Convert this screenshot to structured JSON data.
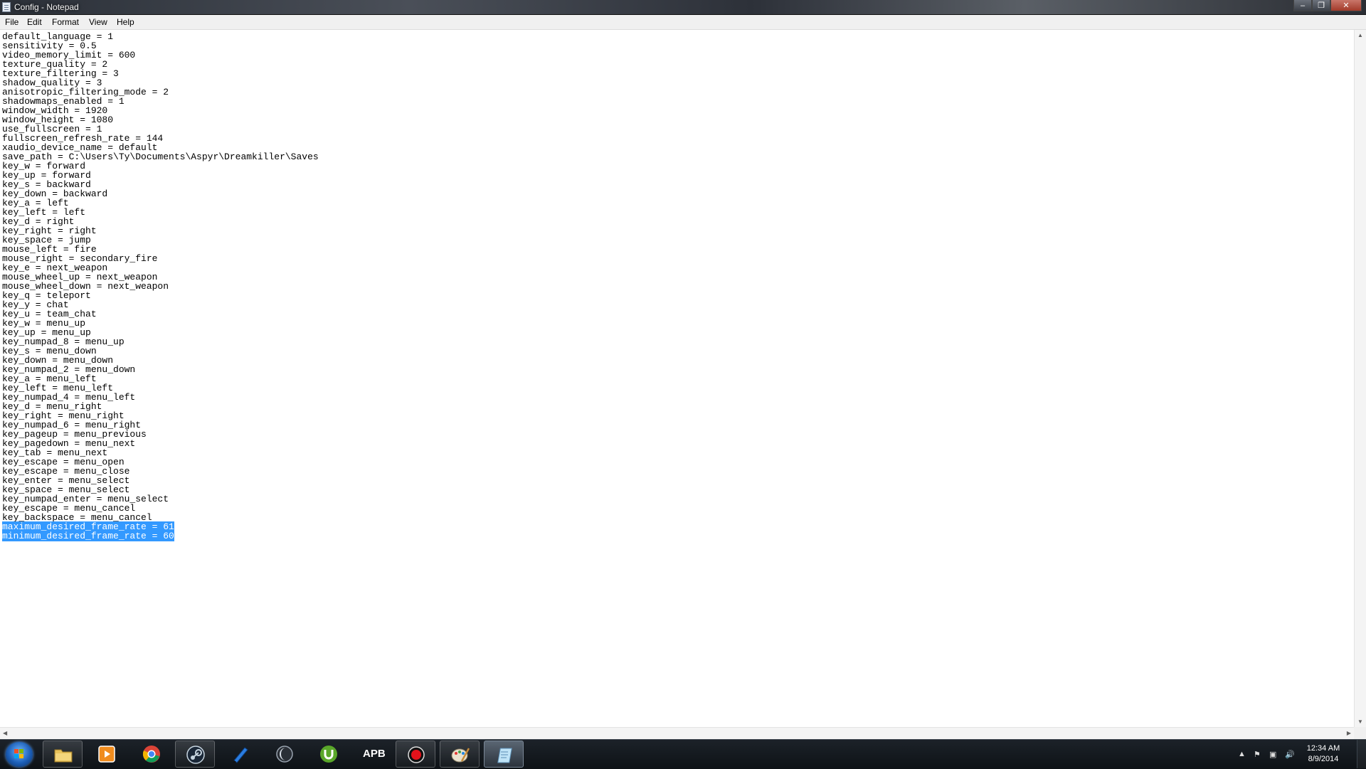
{
  "window": {
    "title": "Config - Notepad",
    "minimize_icon": "minimize-icon",
    "maximize_icon": "maximize-icon",
    "close_icon": "close-icon"
  },
  "menu": {
    "items": [
      "File",
      "Edit",
      "Format",
      "View",
      "Help"
    ]
  },
  "editor": {
    "lines": [
      "default_language = 1",
      "sensitivity = 0.5",
      "video_memory_limit = 600",
      "texture_quality = 2",
      "texture_filtering = 3",
      "shadow_quality = 3",
      "anisotropic_filtering_mode = 2",
      "shadowmaps_enabled = 1",
      "window_width = 1920",
      "window_height = 1080",
      "use_fullscreen = 1",
      "fullscreen_refresh_rate = 144",
      "xaudio_device_name = default",
      "save_path = C:\\Users\\Ty\\Documents\\Aspyr\\Dreamkiller\\Saves",
      "key_w = forward",
      "key_up = forward",
      "key_s = backward",
      "key_down = backward",
      "key_a = left",
      "key_left = left",
      "key_d = right",
      "key_right = right",
      "key_space = jump",
      "mouse_left = fire",
      "mouse_right = secondary_fire",
      "key_e = next_weapon",
      "mouse_wheel_up = next_weapon",
      "mouse_wheel_down = next_weapon",
      "key_q = teleport",
      "key_y = chat",
      "key_u = team_chat",
      "key_w = menu_up",
      "key_up = menu_up",
      "key_numpad_8 = menu_up",
      "key_s = menu_down",
      "key_down = menu_down",
      "key_numpad_2 = menu_down",
      "key_a = menu_left",
      "key_left = menu_left",
      "key_numpad_4 = menu_left",
      "key_d = menu_right",
      "key_right = menu_right",
      "key_numpad_6 = menu_right",
      "key_pageup = menu_previous",
      "key_pagedown = menu_next",
      "key_tab = menu_next",
      "key_escape = menu_open",
      "key_escape = menu_close",
      "key_enter = menu_select",
      "key_space = menu_select",
      "key_numpad_enter = menu_select",
      "key_escape = menu_cancel",
      "key_backspace = menu_cancel",
      "maximum_desired_frame_rate = 61",
      "minimum_desired_frame_rate = 60"
    ],
    "selected_lines": [
      53,
      54
    ]
  },
  "taskbar": {
    "apps": [
      {
        "name": "windows-explorer",
        "icon": "folder-icon",
        "state": "running"
      },
      {
        "name": "media-player",
        "icon": "play-icon",
        "state": "normal"
      },
      {
        "name": "chrome",
        "icon": "chrome-icon",
        "state": "normal"
      },
      {
        "name": "steam",
        "icon": "steam-icon",
        "state": "running"
      },
      {
        "name": "pen-app",
        "icon": "pen-icon",
        "state": "normal"
      },
      {
        "name": "app-moon",
        "icon": "moon-icon",
        "state": "normal"
      },
      {
        "name": "utorrent",
        "icon": "utorrent-icon",
        "state": "normal"
      },
      {
        "name": "apb",
        "icon": "apb-icon",
        "state": "normal"
      },
      {
        "name": "recorder",
        "icon": "record-icon",
        "state": "running"
      },
      {
        "name": "paint",
        "icon": "paint-icon",
        "state": "running"
      },
      {
        "name": "notepad",
        "icon": "notepad-icon",
        "state": "active"
      }
    ],
    "apb_label": "APB",
    "clock_time": "12:34 AM",
    "clock_date": "8/9/2014"
  }
}
